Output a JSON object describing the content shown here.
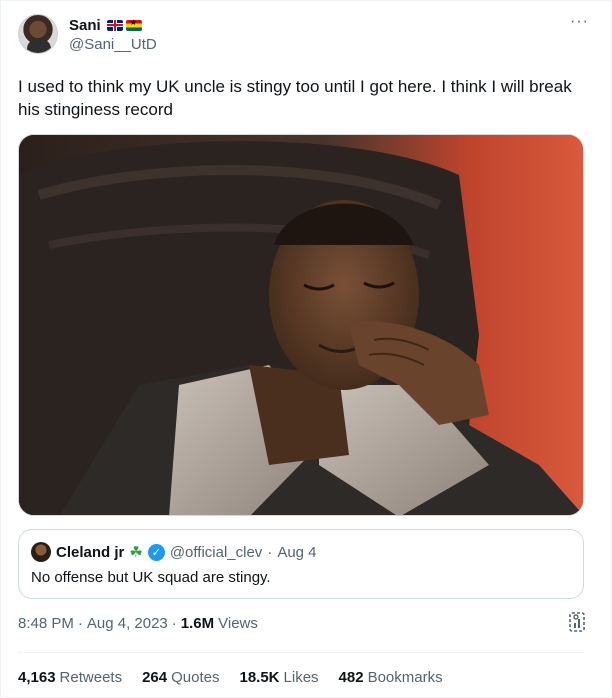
{
  "author": {
    "display_name": "Sani",
    "handle": "@Sani__UtD",
    "name_emojis": [
      "apple-emoji",
      "uk-flag-emoji",
      "ghana-flag-emoji"
    ]
  },
  "more_label": "···",
  "tweet": {
    "text": "I used to think my UK uncle is stingy too until I got here. I think I will break his stinginess record"
  },
  "quote": {
    "name": "Cleland jr",
    "emoji": "☘",
    "handle": "@official_clev",
    "separator": "·",
    "date": "Aug 4",
    "text": "No offense but UK squad are stingy."
  },
  "meta": {
    "time": "8:48 PM",
    "dot1": "·",
    "date": "Aug 4, 2023",
    "dot2": "·",
    "views_count": "1.6M",
    "views_label": "Views"
  },
  "stats": [
    {
      "count": "4,163",
      "label": "Retweets"
    },
    {
      "count": "264",
      "label": "Quotes"
    },
    {
      "count": "18.5K",
      "label": "Likes"
    },
    {
      "count": "482",
      "label": "Bookmarks"
    }
  ],
  "colors": {
    "text_primary": "#0f1419",
    "text_secondary": "#536471",
    "border": "#cfd9de",
    "verified_blue": "#1d9bf0"
  }
}
